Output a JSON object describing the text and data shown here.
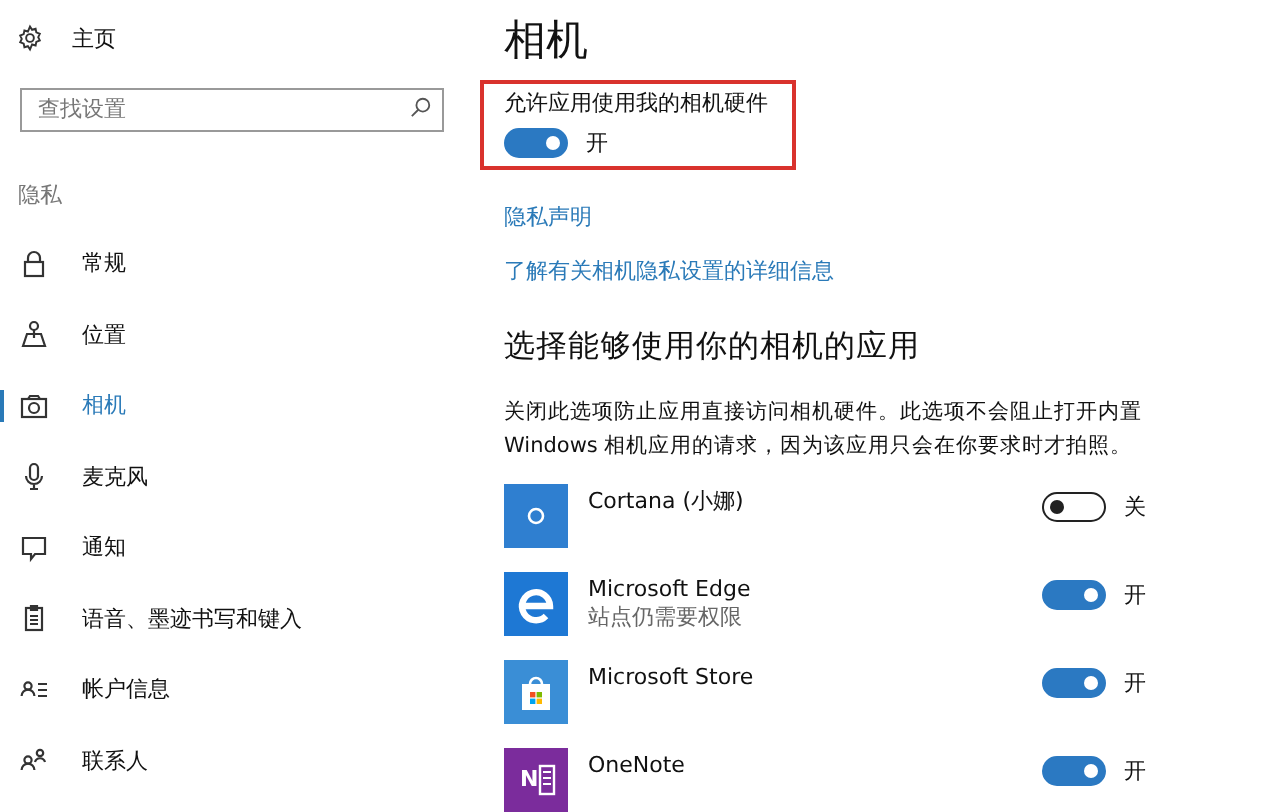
{
  "sidebar": {
    "home": {
      "label": "主页"
    },
    "search": {
      "placeholder": "查找设置"
    },
    "section": "隐私",
    "items": [
      {
        "label": "常规",
        "kind": "lock",
        "selected": false
      },
      {
        "label": "位置",
        "kind": "location",
        "selected": false
      },
      {
        "label": "相机",
        "kind": "camera",
        "selected": true
      },
      {
        "label": "麦克风",
        "kind": "mic",
        "selected": false
      },
      {
        "label": "通知",
        "kind": "chat",
        "selected": false
      },
      {
        "label": "语音、墨迹书写和键入",
        "kind": "doc",
        "selected": false
      },
      {
        "label": "帐户信息",
        "kind": "account",
        "selected": false
      },
      {
        "label": "联系人",
        "kind": "people",
        "selected": false
      }
    ]
  },
  "page": {
    "title": "相机",
    "master": {
      "label": "允许应用使用我的相机硬件",
      "on": true,
      "state": "开"
    },
    "links": [
      "隐私声明",
      "了解有关相机隐私设置的详细信息"
    ],
    "subtitle": "选择能够使用你的相机的应用",
    "description": "关闭此选项防止应用直接访问相机硬件。此选项不会阻止打开内置 Windows 相机应用的请求，因为该应用只会在你要求时才拍照。",
    "apps": [
      {
        "name": "Cortana (小娜)",
        "kind": "cortana",
        "on": false,
        "state": "关"
      },
      {
        "name": "Microsoft Edge",
        "note": "站点仍需要权限",
        "kind": "edge",
        "on": true,
        "state": "开"
      },
      {
        "name": "Microsoft Store",
        "kind": "store",
        "on": true,
        "state": "开"
      },
      {
        "name": "OneNote",
        "kind": "onenote",
        "badge": "N",
        "on": true,
        "state": "开"
      }
    ]
  }
}
